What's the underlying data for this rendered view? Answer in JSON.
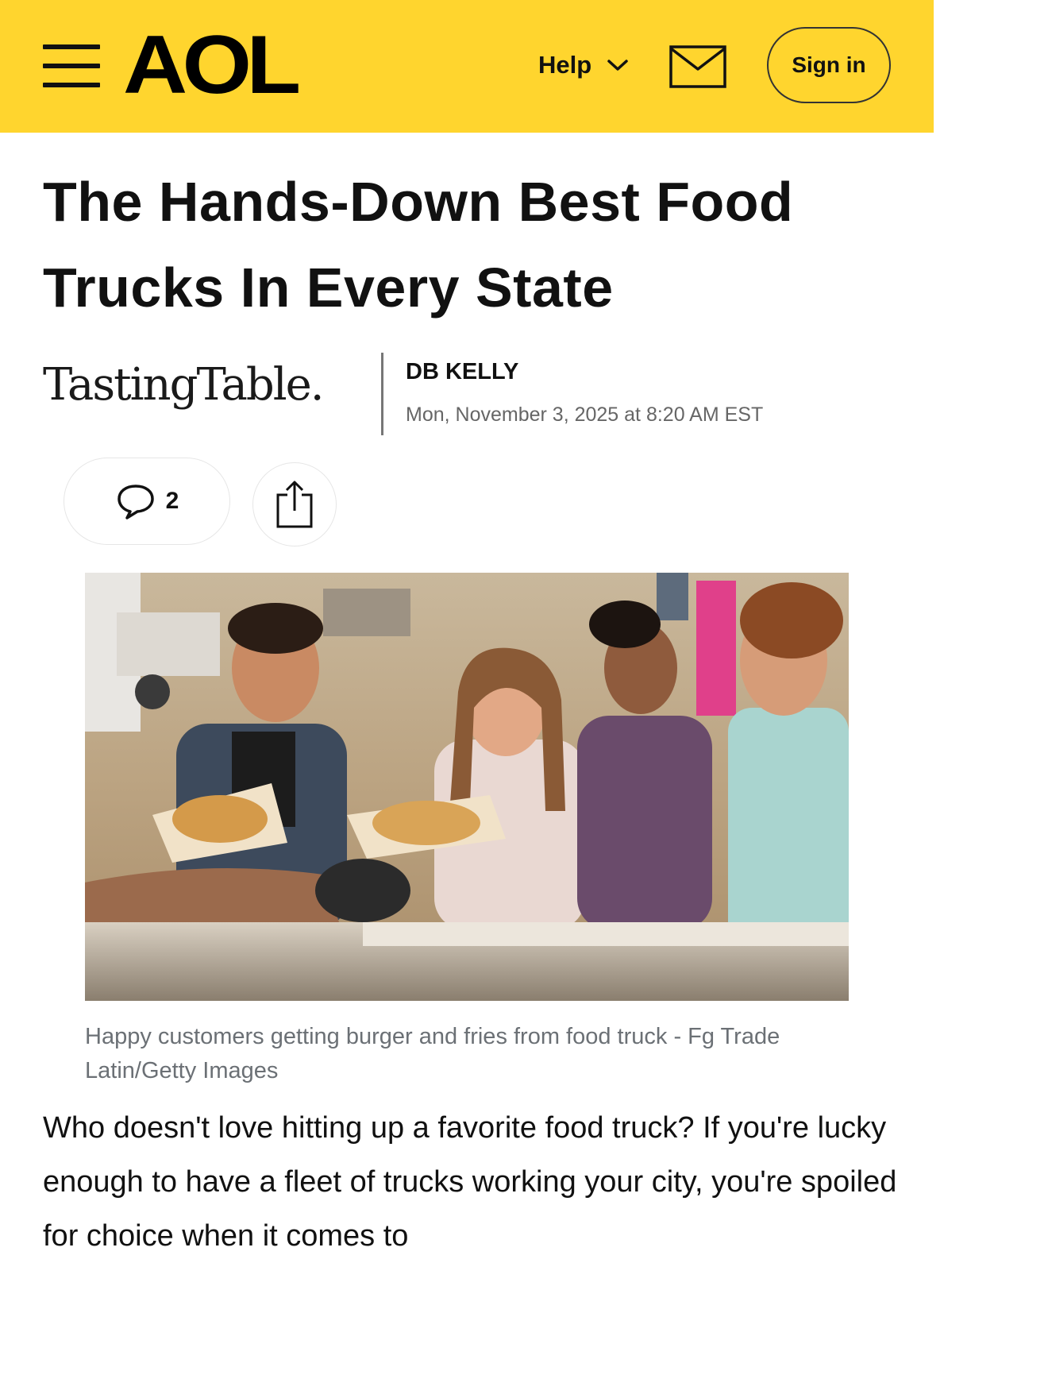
{
  "header": {
    "logo_text": "AOL",
    "help_label": "Help",
    "sign_in_label": "Sign in",
    "brand_color": "#ffd52e",
    "icons": [
      "menu-icon",
      "chevron-down-icon",
      "mail-icon"
    ]
  },
  "article": {
    "title": "The Hands-Down Best Food Trucks In Every State",
    "source": "TastingTable.",
    "author": "DB KELLY",
    "date": "Mon, November 3, 2025 at 8:20 AM EST",
    "comment_count": "2",
    "image_caption": "Happy customers getting burger and fries from food truck - Fg Trade Latin/Getty Images",
    "body": "Who doesn't love hitting up a favorite food truck? If you're lucky enough to have a fleet of trucks working your city, you're spoiled for choice when it comes to"
  },
  "actions": {
    "icons": [
      "comment-icon",
      "share-icon"
    ]
  }
}
